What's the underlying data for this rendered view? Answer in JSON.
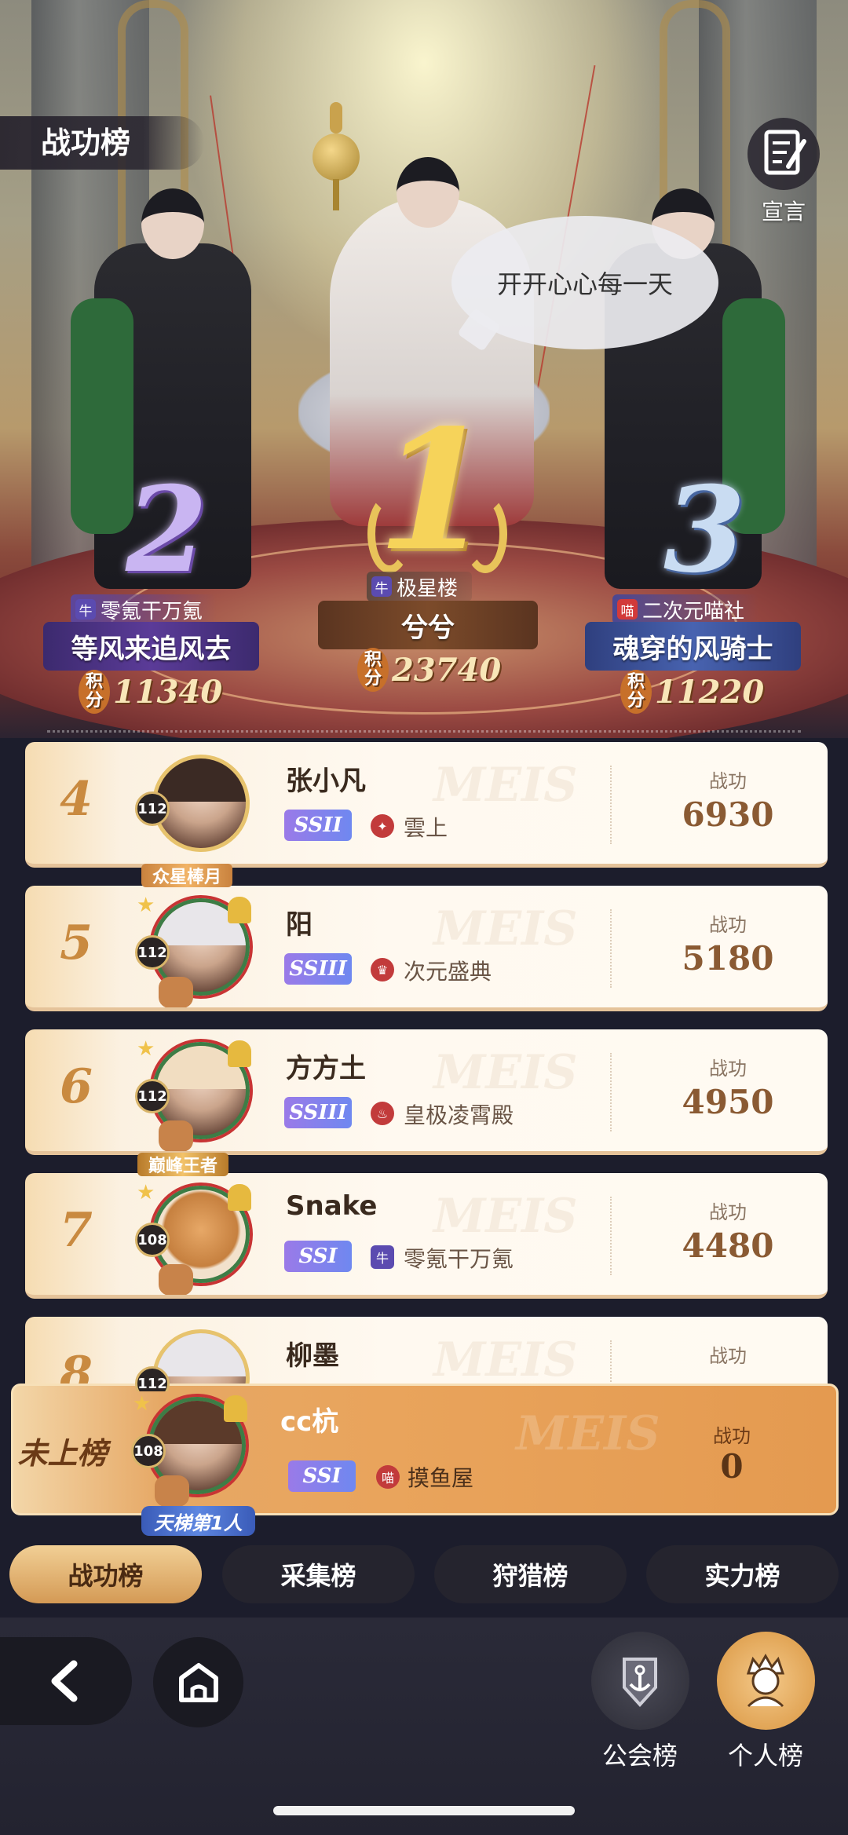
{
  "header": {
    "title": "战功榜",
    "declare_label": "宣言",
    "bubble_text": "开开心心每一天"
  },
  "podium": [
    {
      "rank": "1",
      "guild_badge": "牛",
      "guild": "极星楼",
      "name": "兮兮",
      "points_label": "积分",
      "score": "23740"
    },
    {
      "rank": "2",
      "guild_badge": "牛",
      "guild": "零氪干万氪",
      "name": "等风来追风去",
      "points_label": "积分",
      "score": "11340"
    },
    {
      "rank": "3",
      "guild_badge": "喵",
      "guild": "二次元喵社",
      "name": "魂穿的风骑士",
      "points_label": "积分",
      "score": "11220"
    }
  ],
  "list": {
    "score_label": "战功",
    "rows": [
      {
        "rank": "4",
        "level": "112",
        "name": "张小凡",
        "tier": "SSII",
        "guild": "雲上",
        "score": "6930"
      },
      {
        "rank": "5",
        "level": "112",
        "name": "阳",
        "tier": "SSIII",
        "guild": "次元盛典",
        "score": "5180"
      },
      {
        "rank": "6",
        "level": "112",
        "name": "方方土",
        "tier": "SSIII",
        "guild": "皇极凌霄殿",
        "score": "4950"
      },
      {
        "rank": "7",
        "level": "108",
        "name": "Snake",
        "tier": "SSI",
        "guild": "零氪干万氪",
        "score": "4480"
      },
      {
        "rank": "8",
        "level": "112",
        "name": "柳墨",
        "tier": "",
        "guild": "",
        "score": ""
      }
    ],
    "badges": {
      "row5": "众星棒月",
      "row7": "巅峰王者"
    }
  },
  "self": {
    "status": "未上榜",
    "level": "108",
    "name": "cc杭",
    "tier": "SSI",
    "guild": "摸鱼屋",
    "score_label": "战功",
    "score": "0",
    "badge": "天梯第1人"
  },
  "tabs": [
    {
      "label": "战功榜",
      "active": true
    },
    {
      "label": "采集榜",
      "active": false
    },
    {
      "label": "狩猎榜",
      "active": false
    },
    {
      "label": "实力榜",
      "active": false
    }
  ],
  "bottom": {
    "guild_board": "公会榜",
    "personal_board": "个人榜"
  },
  "colors": {
    "accent_gold": "#d49a55",
    "rank_gold": "#c98a40",
    "background": "#1c1d2c"
  },
  "icons": [
    "declare-icon",
    "back-icon",
    "home-icon",
    "anchor-shield-icon",
    "personal-avatar-icon"
  ]
}
